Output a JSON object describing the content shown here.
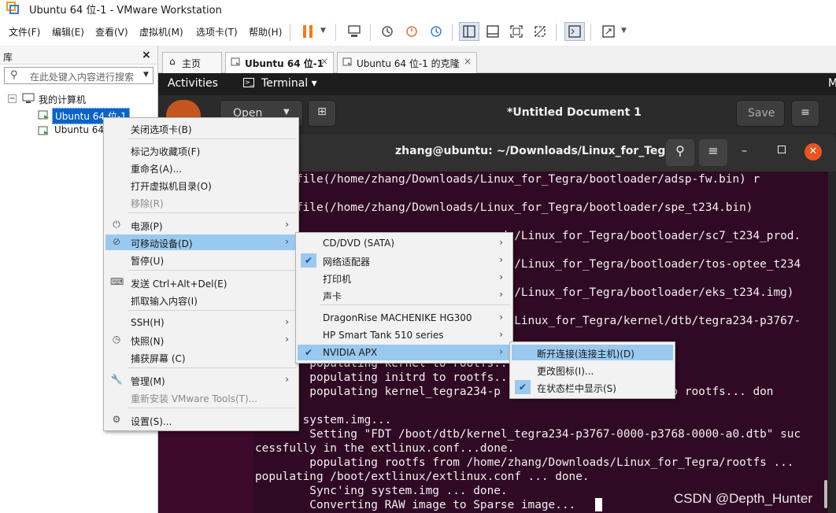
{
  "window": {
    "title": "Ubuntu 64 位-1 - VMware Workstation"
  },
  "menu": [
    "文件(F)",
    "编辑(E)",
    "查看(V)",
    "虚拟机(M)",
    "选项卡(T)",
    "帮助(H)"
  ],
  "library": {
    "title": "库",
    "close": "×",
    "search_placeholder": "在此处键入内容进行搜索",
    "tree": {
      "root": "我的计算机",
      "items": [
        "Ubuntu 64 位-1",
        "Ubuntu 64"
      ]
    }
  },
  "tabs": [
    {
      "label": "主页",
      "close": ""
    },
    {
      "label": "Ubuntu 64 位-1",
      "close": "×"
    },
    {
      "label": "Ubuntu 64 位-1 的克隆",
      "close": "×"
    }
  ],
  "ubuntu": {
    "activities": "Activities",
    "terminal": "Terminal ▾",
    "topright": "M"
  },
  "gedit": {
    "open": "Open",
    "doc_title": "*Untitled Document 1",
    "save": "Save"
  },
  "terminal": {
    "title": "zhang@ubuntu: ~/Downloads/Linux_for_Tegra",
    "lines": [
      "ng apefile(/home/zhang/Downloads/Linux_for_Tegra/bootloader/adsp-fw.bin) r",
      "",
      "ng spefile(/home/zhang/Downloads/Linux_for_Tegra/bootloader/spe_t234.bin)",
      "",
      "                                    ds/Linux_for_Tegra/bootloader/sc7_t234_prod.",
      "",
      "                                    ds/Linux_for_Tegra/bootloader/tos-optee_t234",
      "",
      "                                    ds/Linux_for_Tegra/bootloader/eks_t234.img)",
      "",
      "                                    s/Linux_for_Tegra/kernel/dtb/tegra234-p3767-",
      "",
      "",
      "        populating kernel to rootfs...",
      "        populating initrd to rootfs...",
      "        populating kernel_tegra234-p                   .dtb to rootfs... don",
      "",
      "       system.img...",
      "        Setting \"FDT /boot/dtb/kernel_tegra234-p3767-0000-p3768-0000-a0.dtb\" suc",
      "cessfully in the extlinux.conf...done.",
      "        populating rootfs from /home/zhang/Downloads/Linux_for_Tegra/rootfs ...",
      "populating /boot/extlinux/extlinux.conf ... done.",
      "        Sync'ing system.img ... done.",
      "        Converting RAW image to Sparse image... "
    ]
  },
  "context_menu": [
    {
      "label": "关闭选项卡(B)",
      "disabled": false
    },
    {
      "label": "标记为收藏项(F)",
      "disabled": false
    },
    {
      "label": "重命名(A)...",
      "disabled": false
    },
    {
      "label": "打开虚拟机目录(O)",
      "disabled": false
    },
    {
      "label": "移除(R)",
      "disabled": true
    },
    {
      "label": "电源(P)",
      "disabled": false,
      "submenu": true
    },
    {
      "label": "可移动设备(D)",
      "disabled": false,
      "submenu": true
    },
    {
      "label": "暂停(U)",
      "disabled": false
    },
    {
      "label": "发送 Ctrl+Alt+Del(E)",
      "disabled": false
    },
    {
      "label": "抓取输入内容(I)",
      "disabled": false
    },
    {
      "label": "SSH(H)",
      "disabled": false,
      "submenu": true
    },
    {
      "label": "快照(N)",
      "disabled": false,
      "submenu": true
    },
    {
      "label": "捕获屏幕 (C)",
      "disabled": false
    },
    {
      "label": "管理(M)",
      "disabled": false,
      "submenu": true
    },
    {
      "label": "重新安装 VMware Tools(T)...",
      "disabled": true
    },
    {
      "label": "设置(S)...",
      "disabled": false
    }
  ],
  "removable_menu": [
    {
      "label": "CD/DVD (SATA)",
      "checked": false
    },
    {
      "label": "网络适配器",
      "checked": true
    },
    {
      "label": "打印机",
      "checked": false
    },
    {
      "label": "声卡",
      "checked": false
    },
    {
      "label": "DragonRise MACHENIKE HG300",
      "checked": false
    },
    {
      "label": "HP Smart Tank 510 series",
      "checked": false
    },
    {
      "label": "NVIDIA APX",
      "checked": true
    }
  ],
  "nvidia_menu": [
    {
      "label": "断开连接(连接主机)(D)",
      "checked": false
    },
    {
      "label": "更改图标(I)...",
      "checked": false
    },
    {
      "label": "在状态栏中显示(S)",
      "checked": true
    }
  ],
  "watermark": "CSDN @Depth_Hunter"
}
